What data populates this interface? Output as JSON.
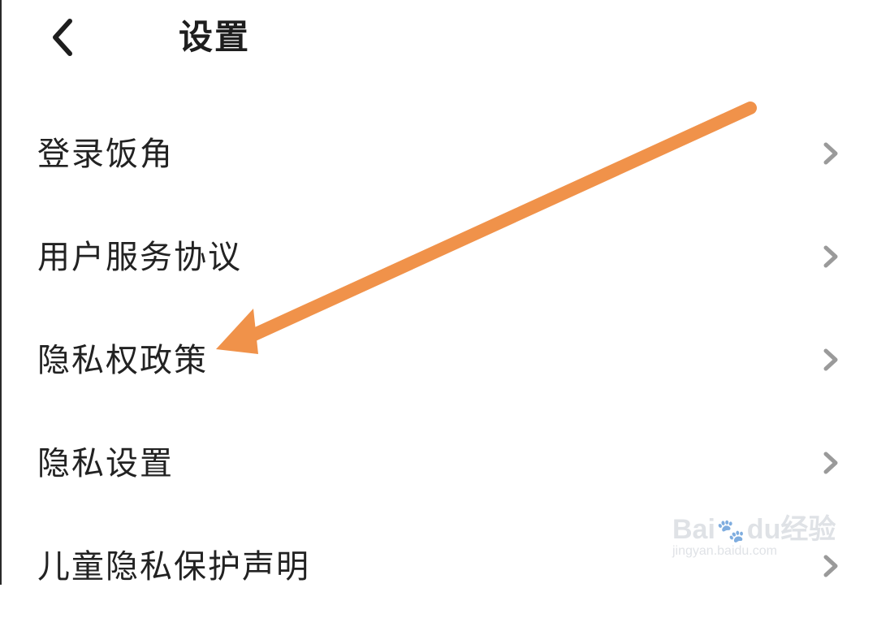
{
  "header": {
    "title": "设置",
    "back_icon": "chevron-left-icon"
  },
  "menu": {
    "items": [
      {
        "label": "登录饭角",
        "icon": "chevron-right-icon"
      },
      {
        "label": "用户服务协议",
        "icon": "chevron-right-icon"
      },
      {
        "label": "隐私权政策",
        "icon": "chevron-right-icon"
      },
      {
        "label": "隐私设置",
        "icon": "chevron-right-icon"
      },
      {
        "label": "儿童隐私保护声明",
        "icon": "chevron-right-icon"
      }
    ]
  },
  "annotation": {
    "arrow_color": "#F0924A",
    "points_to": "隐私权政策"
  },
  "watermark": {
    "logo_text_a": "Bai",
    "logo_text_b": "du",
    "logo_text_c": "经验",
    "url": "jingyan.baidu.com"
  },
  "colors": {
    "background": "#FFFFFF",
    "text": "#222222",
    "chevron": "#9A9A9A"
  }
}
